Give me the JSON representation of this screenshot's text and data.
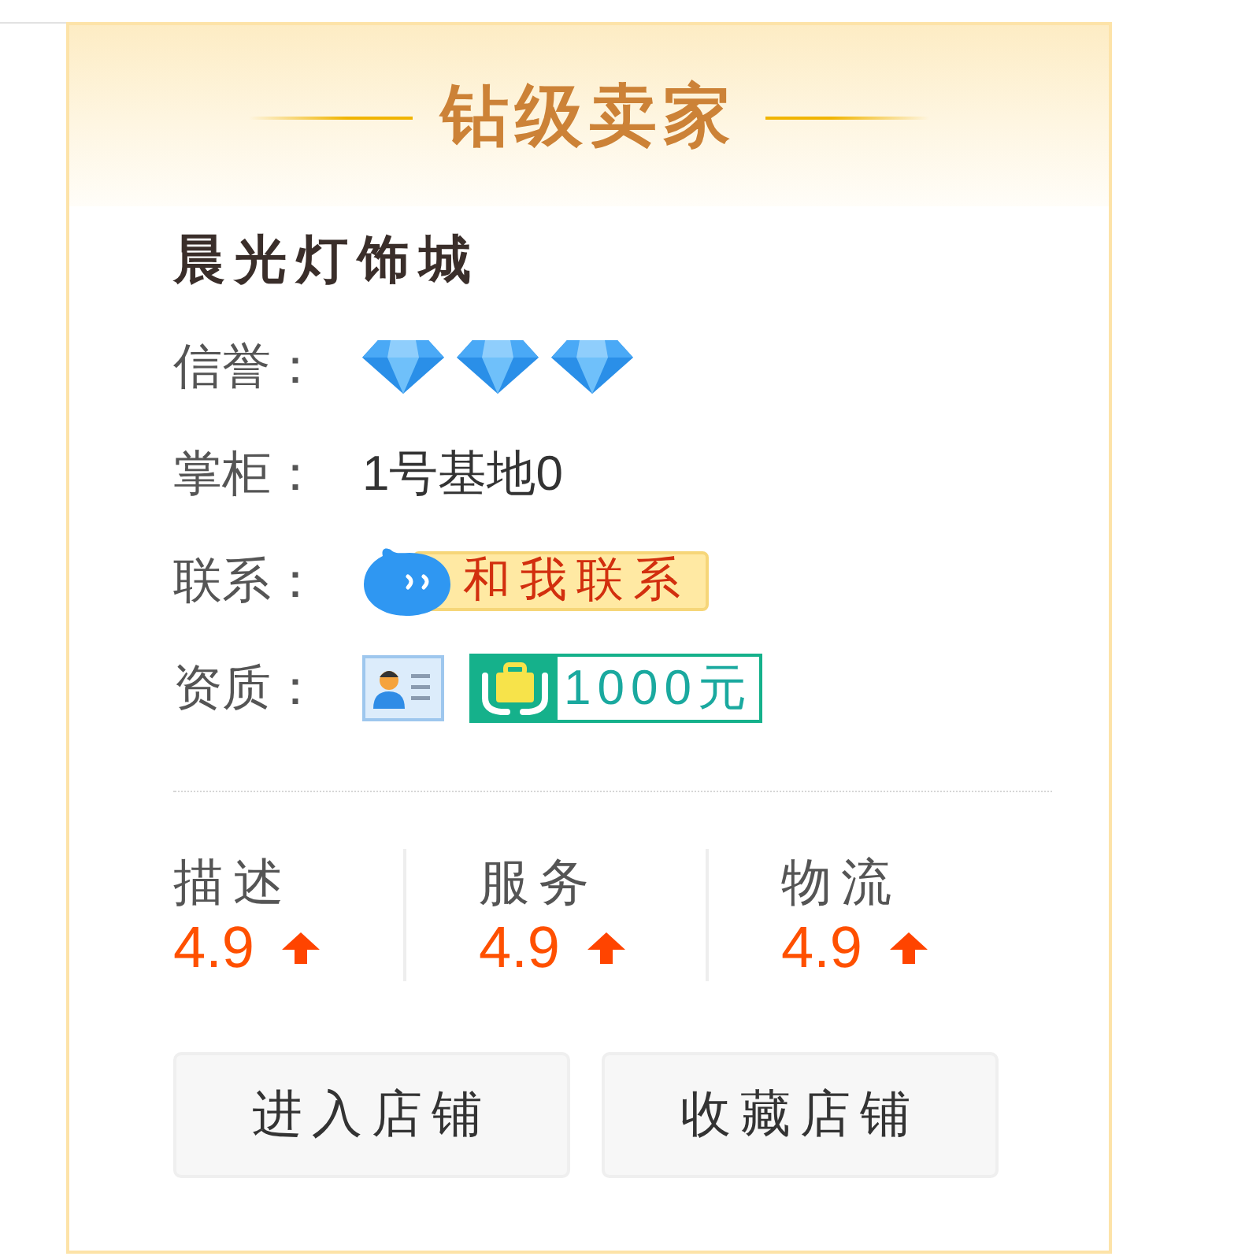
{
  "header": {
    "title": "钻级卖家"
  },
  "shop": {
    "name": "晨光灯饰城"
  },
  "info_rows": [
    {
      "kind": "credit",
      "label": "信誉：",
      "credit_icons": [
        {
          "kind": "diamond"
        },
        {
          "kind": "diamond"
        },
        {
          "kind": "diamond"
        }
      ]
    },
    {
      "kind": "text",
      "label": "掌柜：",
      "value": "1号基地0"
    },
    {
      "kind": "contact",
      "label": "联系：",
      "button": "和我联系"
    },
    {
      "kind": "qualification",
      "label": "资质：",
      "deposit": "1000元"
    }
  ],
  "ratings": [
    {
      "label": "描述",
      "score": "4.9",
      "up": true
    },
    {
      "label": "服务",
      "score": "4.9",
      "up": true
    },
    {
      "label": "物流",
      "score": "4.9",
      "up": true
    }
  ],
  "buttons": [
    "进入店铺",
    "收藏店铺"
  ]
}
